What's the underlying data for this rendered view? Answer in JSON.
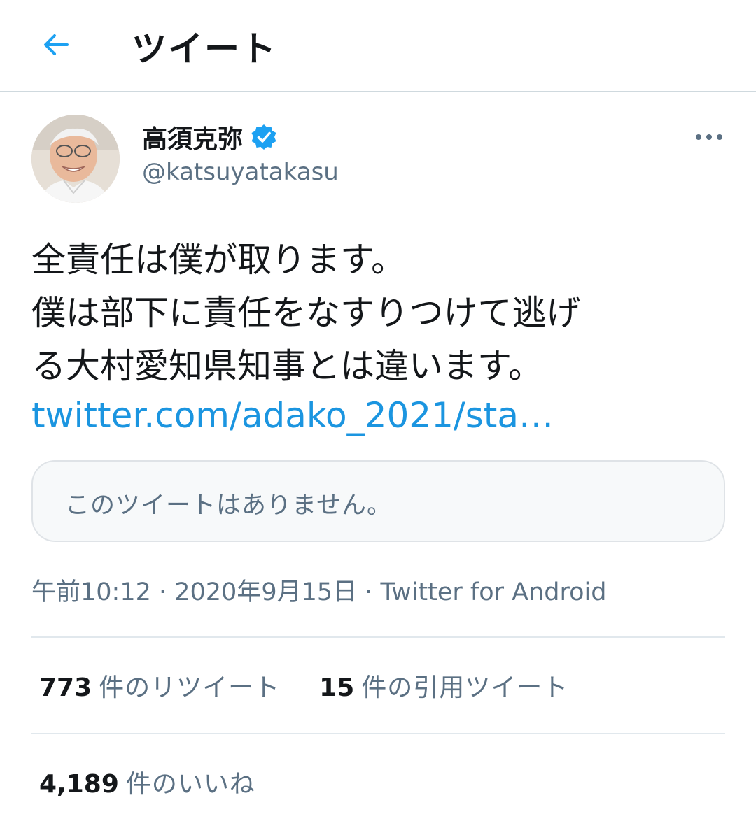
{
  "header": {
    "back_icon": "arrow-left-icon",
    "title": "ツイート",
    "accent_color": "#1da1f2"
  },
  "tweet": {
    "author": {
      "display_name": "高須克弥",
      "verified_icon": "verified-badge-icon",
      "handle": "@katsuyatakasu",
      "avatar_icon": "avatar-photo"
    },
    "more_icon": "more-dots-icon",
    "text_lines": [
      "全責任は僕が取ります。",
      "僕は部下に責任をなすりつけて逃げ",
      "る大村愛知県知事とは違います。"
    ],
    "link_text": "twitter.com/adako_2021/sta…",
    "link_color": "#1b95e0",
    "quoted_tweet": {
      "unavailable_text": "このツイートはありません。"
    },
    "meta": "午前10:12 · 2020年9月15日 · Twitter for Android",
    "stats": {
      "retweets": {
        "count": "773",
        "label": "件のリツイート"
      },
      "quotes": {
        "count": "15",
        "label": "件の引用ツイート"
      },
      "likes": {
        "count": "4,189",
        "label": "件のいいね"
      }
    }
  }
}
